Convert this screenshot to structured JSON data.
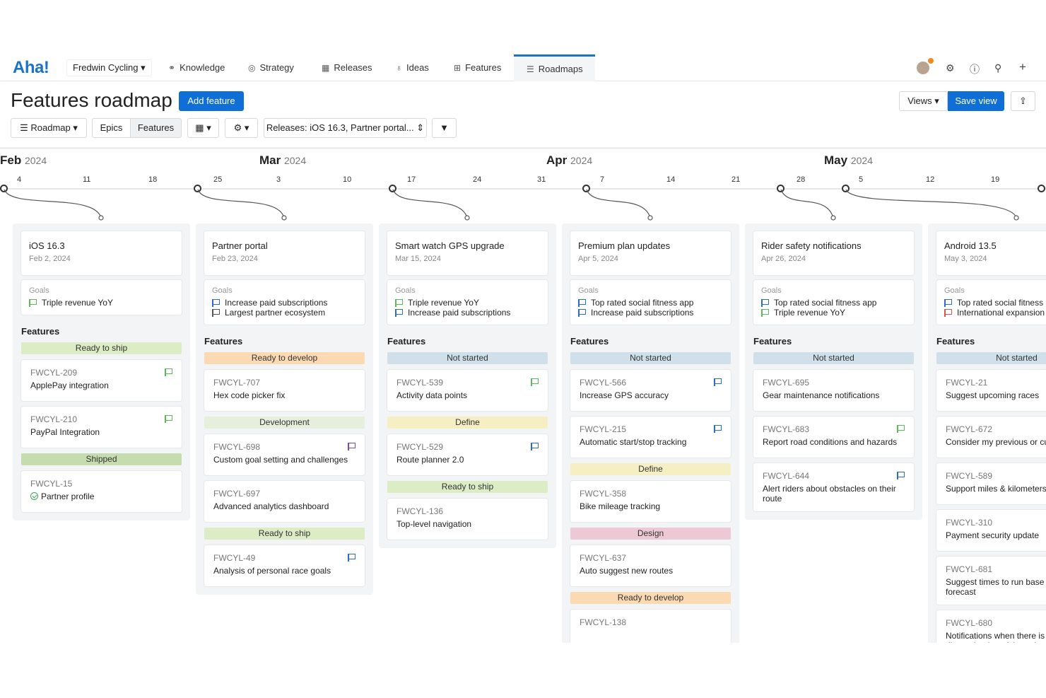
{
  "nav": {
    "logo": "Aha!",
    "workspace": "Fredwin Cycling",
    "tabs": [
      {
        "label": "Knowledge",
        "icon": "knowledge-icon"
      },
      {
        "label": "Strategy",
        "icon": "target-icon"
      },
      {
        "label": "Releases",
        "icon": "calendar-icon"
      },
      {
        "label": "Ideas",
        "icon": "lightbulb-icon"
      },
      {
        "label": "Features",
        "icon": "grid-icon"
      },
      {
        "label": "Roadmaps",
        "icon": "roadmap-icon",
        "active": true
      }
    ],
    "right_icons": [
      "avatar",
      "gear-icon",
      "help-icon",
      "search-icon",
      "plus-icon"
    ]
  },
  "header": {
    "title": "Features roadmap",
    "add_feature": "Add feature",
    "views": "Views",
    "save_view": "Save view"
  },
  "toolbar": {
    "roadmap": "Roadmap",
    "epics": "Epics",
    "features": "Features",
    "releases_filter": "Releases: iOS 16.3, Partner portal..."
  },
  "timeline": {
    "months": [
      {
        "name": "Feb",
        "year": "2024"
      },
      {
        "name": "Mar",
        "year": "2024"
      },
      {
        "name": "Apr",
        "year": "2024"
      },
      {
        "name": "May",
        "year": "2024"
      }
    ],
    "ticks": [
      "4",
      "11",
      "18",
      "25",
      "3",
      "10",
      "17",
      "24",
      "31",
      "7",
      "14",
      "21",
      "28",
      "5",
      "12",
      "19"
    ]
  },
  "colors": {
    "ready_to_ship": "#dcecc4",
    "shipped": "#c4dcae",
    "ready_to_develop": "#fbd9b3",
    "development": "#e6efdc",
    "not_started": "#cfe0ea",
    "define": "#f7efc4",
    "design": "#ecc9d4",
    "flag_green": "#5db85b",
    "flag_blue": "#2d6cc9",
    "flag_purple": "#7a4d99",
    "flag_red": "#d9534f"
  },
  "releases": [
    {
      "name": "iOS 16.3",
      "date": "Feb 2, 2024",
      "goals_label": "Goals",
      "goals": [
        {
          "text": "Triple revenue YoY",
          "color": "#5db85b"
        }
      ],
      "features_label": "Features",
      "groups": [
        {
          "status": "Ready to ship",
          "color": "#dcecc4",
          "features": [
            {
              "id": "FWCYL-209",
              "name": "ApplePay integration",
              "flag": "#5db85b"
            },
            {
              "id": "FWCYL-210",
              "name": "PayPal Integration",
              "flag": "#5db85b"
            }
          ]
        },
        {
          "status": "Shipped",
          "color": "#c4dcae",
          "features": [
            {
              "id": "FWCYL-15",
              "name": "Partner profile",
              "check": true
            }
          ]
        }
      ]
    },
    {
      "name": "Partner portal",
      "date": "Feb 23, 2024",
      "goals_label": "Goals",
      "goals": [
        {
          "text": "Increase paid subscriptions",
          "color": "#2d6cc9"
        },
        {
          "text": "Largest partner ecosystem",
          "color": "#555555"
        }
      ],
      "features_label": "Features",
      "groups": [
        {
          "status": "Ready to develop",
          "color": "#fbd9b3",
          "features": [
            {
              "id": "FWCYL-707",
              "name": "Hex code picker fix"
            }
          ]
        },
        {
          "status": "Development",
          "color": "#e6efdc",
          "features": [
            {
              "id": "FWCYL-698",
              "name": "Custom goal setting and challenges",
              "flag": "#7a4d99"
            },
            {
              "id": "FWCYL-697",
              "name": "Advanced analytics dashboard"
            }
          ]
        },
        {
          "status": "Ready to ship",
          "color": "#dcecc4",
          "features": [
            {
              "id": "FWCYL-49",
              "name": "Analysis of personal race goals",
              "flag": "#2d6cc9"
            }
          ]
        }
      ]
    },
    {
      "name": "Smart watch GPS upgrade",
      "date": "Mar 15, 2024",
      "goals_label": "Goals",
      "goals": [
        {
          "text": "Triple revenue YoY",
          "color": "#5db85b"
        },
        {
          "text": "Increase paid subscriptions",
          "color": "#2d6cc9"
        }
      ],
      "features_label": "Features",
      "groups": [
        {
          "status": "Not started",
          "color": "#cfe0ea",
          "features": [
            {
              "id": "FWCYL-539",
              "name": "Activity data points",
              "flag": "#5db85b"
            }
          ]
        },
        {
          "status": "Define",
          "color": "#f7efc4",
          "features": [
            {
              "id": "FWCYL-529",
              "name": "Route planner 2.0",
              "flag": "#2d6cc9"
            }
          ]
        },
        {
          "status": "Ready to ship",
          "color": "#dcecc4",
          "features": [
            {
              "id": "FWCYL-136",
              "name": "Top-level navigation"
            }
          ]
        }
      ]
    },
    {
      "name": "Premium plan updates",
      "date": "Apr 5, 2024",
      "goals_label": "Goals",
      "goals": [
        {
          "text": "Top rated social fitness app",
          "color": "#2d6cc9"
        },
        {
          "text": "Increase paid subscriptions",
          "color": "#2d6cc9"
        }
      ],
      "features_label": "Features",
      "groups": [
        {
          "status": "Not started",
          "color": "#cfe0ea",
          "features": [
            {
              "id": "FWCYL-566",
              "name": "Increase GPS accuracy",
              "flag": "#2d6cc9"
            },
            {
              "id": "FWCYL-215",
              "name": "Automatic start/stop tracking",
              "flag": "#2d6cc9"
            }
          ]
        },
        {
          "status": "Define",
          "color": "#f7efc4",
          "features": [
            {
              "id": "FWCYL-358",
              "name": "Bike mileage tracking"
            }
          ]
        },
        {
          "status": "Design",
          "color": "#ecc9d4",
          "features": [
            {
              "id": "FWCYL-637",
              "name": "Auto suggest new routes"
            }
          ]
        },
        {
          "status": "Ready to develop",
          "color": "#fbd9b3",
          "features": [
            {
              "id": "FWCYL-138",
              "name": ""
            }
          ]
        }
      ]
    },
    {
      "name": "Rider safety notifications",
      "date": "Apr 26, 2024",
      "goals_label": "Goals",
      "goals": [
        {
          "text": "Top rated social fitness app",
          "color": "#2d6cc9"
        },
        {
          "text": "Triple revenue YoY",
          "color": "#5db85b"
        }
      ],
      "features_label": "Features",
      "groups": [
        {
          "status": "Not started",
          "color": "#cfe0ea",
          "features": [
            {
              "id": "FWCYL-695",
              "name": "Gear maintenance notifications"
            },
            {
              "id": "FWCYL-683",
              "name": "Report road conditions and hazards",
              "flag": "#5db85b"
            },
            {
              "id": "FWCYL-644",
              "name": "Alert riders about obstacles on their route",
              "flag": "#2d6cc9"
            }
          ]
        }
      ]
    },
    {
      "name": "Android 13.5",
      "date": "May 3, 2024",
      "goals_label": "Goals",
      "goals": [
        {
          "text": "Top rated social fitness",
          "color": "#2d6cc9"
        },
        {
          "text": "International expansion",
          "color": "#d9534f"
        }
      ],
      "features_label": "Features",
      "groups": [
        {
          "status": "Not started",
          "color": "#cfe0ea",
          "features": [
            {
              "id": "FWCYL-21",
              "name": "Suggest upcoming races"
            },
            {
              "id": "FWCYL-672",
              "name": "Consider my previous or cu injuries"
            },
            {
              "id": "FWCYL-589",
              "name": "Support miles & kilometers"
            },
            {
              "id": "FWCYL-310",
              "name": "Payment security update"
            },
            {
              "id": "FWCYL-681",
              "name": "Suggest times to run base weather forecast"
            },
            {
              "id": "FWCYL-680",
              "name": "Notifications when there is a discussion I participated"
            }
          ]
        }
      ]
    }
  ]
}
